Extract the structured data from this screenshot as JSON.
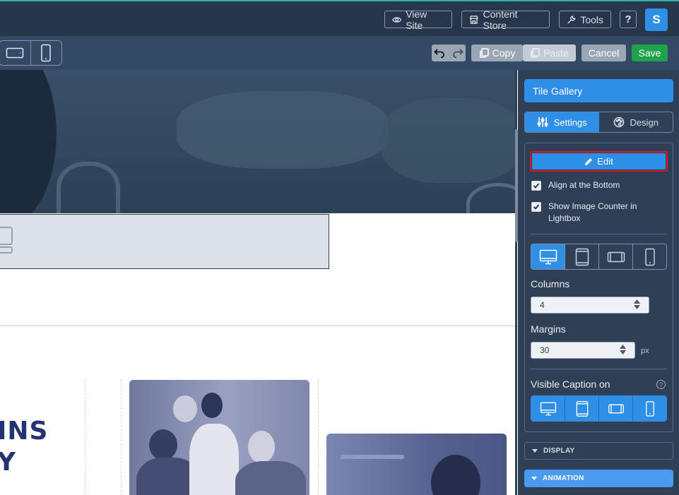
{
  "topbar": {
    "view_site": "View Site",
    "content_store": "Content Store",
    "tools": "Tools",
    "help": "?",
    "avatar_initial": "S"
  },
  "toolbar": {
    "copy": "Copy",
    "paste": "Paste",
    "cancel": "Cancel",
    "save": "Save"
  },
  "canvas": {
    "heading_line1": "INS",
    "heading_line2": "Y"
  },
  "panel": {
    "title": "Tile Gallery",
    "tabs": [
      "Settings",
      "Design"
    ],
    "edit_label": "Edit",
    "align_bottom_label": "Align at the Bottom",
    "show_counter_label": "Show Image Counter in Lightbox",
    "columns_label": "Columns",
    "columns_value": "4",
    "margins_label": "Margins",
    "margins_value": "30",
    "margins_unit": "px",
    "visible_caption_label": "Visible Caption on",
    "help_glyph": "?",
    "display_label": "DISPLAY",
    "animation_label": "ANIMATION"
  },
  "colors": {
    "topbar_bg": "#27364a",
    "toolbar_bg": "#344966",
    "panel_bg": "#2e3f56",
    "accent_blue": "#2f8fe6",
    "save_green": "#1fa34a",
    "highlight_red": "#e3141e",
    "heading_navy": "#243371"
  },
  "icons": {
    "view_site": "eye-icon",
    "content_store": "store-icon",
    "tools": "wrench-icon",
    "edit": "pencil-icon",
    "settings_tab": "sliders-icon",
    "design_tab": "palette-icon"
  }
}
